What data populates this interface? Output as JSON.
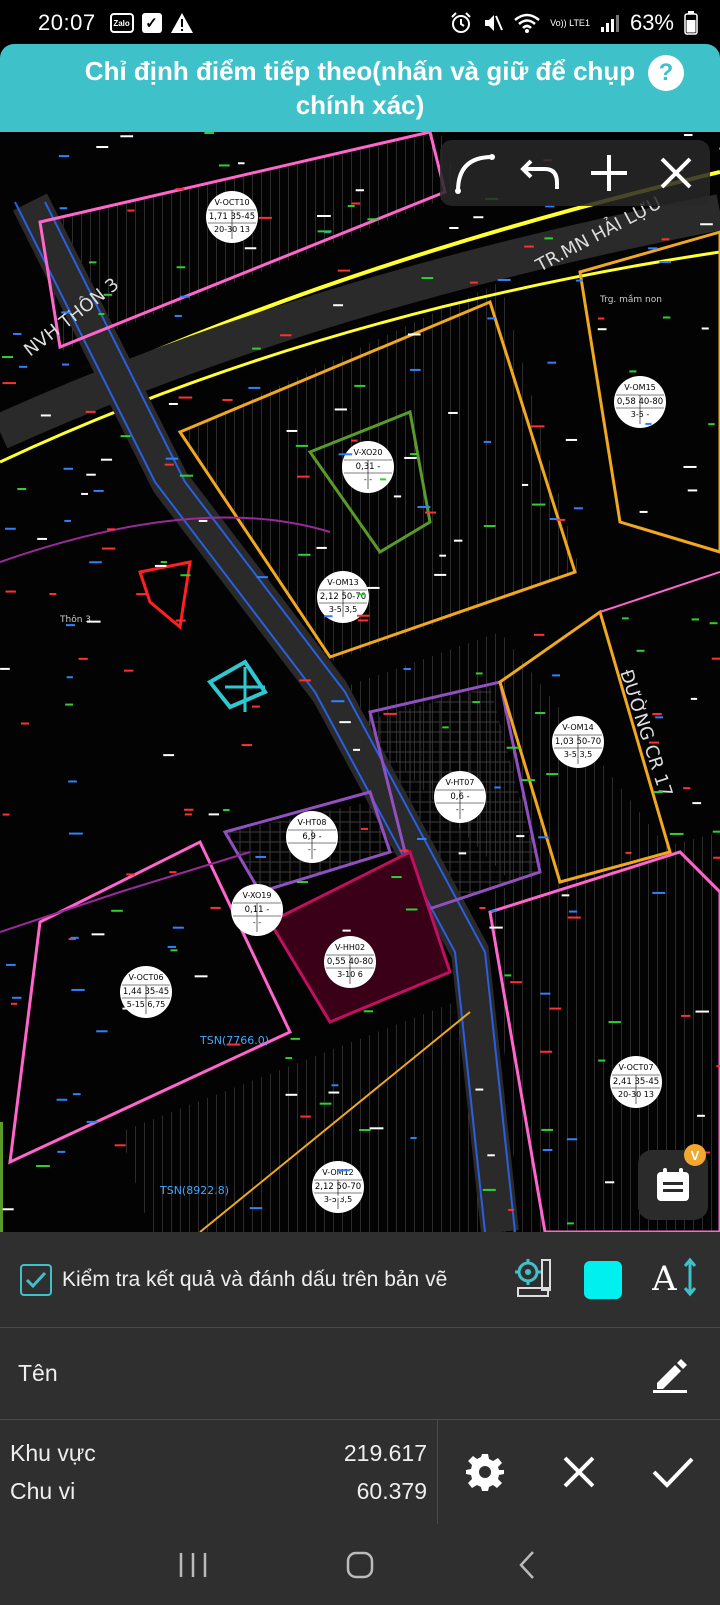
{
  "status": {
    "time": "20:07",
    "left_icons": [
      "zalo-icon",
      "checkbox-notification-icon",
      "warning-icon"
    ],
    "zalo_text": "Zalo",
    "network_label": "Vo)) LTE1",
    "battery": "63%"
  },
  "header": {
    "title": "Chỉ định điểm tiếp theo(nhấn và giữ để chụp chính xác)",
    "help_label": "?"
  },
  "map": {
    "labels": [
      {
        "text": "NVH THÔN 3"
      },
      {
        "text": "TR.MN HẢI LỰU"
      },
      {
        "text": "ĐƯỜNG CR 17"
      },
      {
        "text": "Thôn 3"
      },
      {
        "text": "TSN(7766.0)"
      },
      {
        "text": "TSN(8922.8)"
      },
      {
        "text": "Trg. mầm non"
      }
    ],
    "parcels": [
      {
        "code": "V-OCT10",
        "a": "1,71",
        "b": "35-45",
        "c": "20-30",
        "d": "13"
      },
      {
        "code": "V-XO20",
        "a": "0,31",
        "b": "-",
        "c": "-",
        "d": "-"
      },
      {
        "code": "V-OM13",
        "a": "2,12",
        "b": "50-70",
        "c": "3-5",
        "d": "3,5"
      },
      {
        "code": "V-OM15",
        "a": "0,58",
        "b": "40-80",
        "c": "3-5",
        "d": "-"
      },
      {
        "code": "V-OM14",
        "a": "1,03",
        "b": "50-70",
        "c": "3-5",
        "d": "3,5"
      },
      {
        "code": "V-HT07",
        "a": "0,6",
        "b": "-",
        "c": "-",
        "d": "-"
      },
      {
        "code": "V-HT08",
        "a": "6,9",
        "b": "-",
        "c": "-",
        "d": "-"
      },
      {
        "code": "V-XO19",
        "a": "0,11",
        "b": "-",
        "c": "-",
        "d": "-"
      },
      {
        "code": "V-HH02",
        "a": "0,55",
        "b": "40-80",
        "c": "3-10",
        "d": "6"
      },
      {
        "code": "V-OCT06",
        "a": "1,44",
        "b": "35-45",
        "c": "5-15",
        "d": "6,75"
      },
      {
        "code": "V-OCT07",
        "a": "2,41",
        "b": "35-45",
        "c": "20-30",
        "d": "13"
      },
      {
        "code": "V-OM12",
        "a": "2,12",
        "b": "50-70",
        "c": "3-5",
        "d": "3,5"
      }
    ]
  },
  "toolbar": {
    "icons": [
      "arc-icon",
      "undo-icon",
      "add-icon",
      "close-icon"
    ]
  },
  "fab": {
    "icon": "calendar-icon",
    "badge": "V"
  },
  "panel": {
    "check_label": "Kiểm tra kết quả và đánh dấu trên bản vẽ",
    "checked": true,
    "swatch_color": "#00f0f0",
    "name_label": "Tên",
    "area_label": "Khu vực",
    "area_value": "219.617",
    "perimeter_label": "Chu vi",
    "perimeter_value": "60.379"
  },
  "nav": {
    "icons": [
      "recent-apps-icon",
      "home-icon",
      "back-icon"
    ]
  },
  "colors": {
    "accent": "#3fc1c9",
    "panel": "#2f2f2f"
  }
}
